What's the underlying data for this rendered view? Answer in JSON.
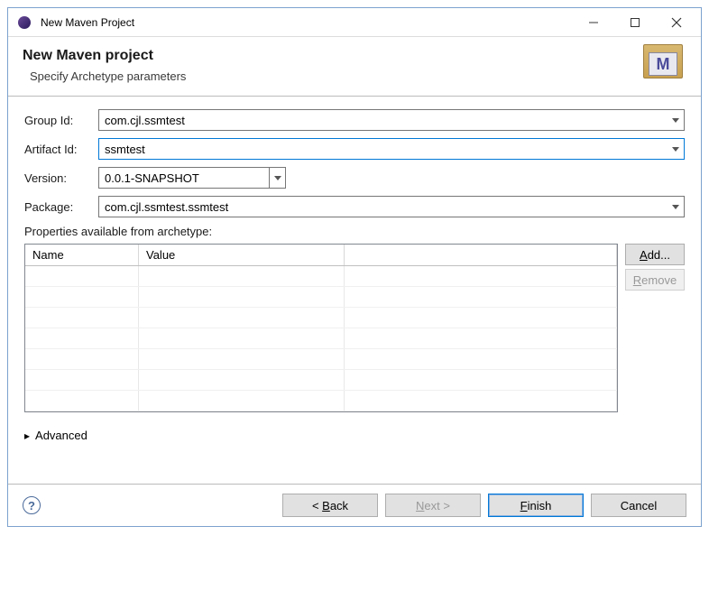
{
  "titlebar": {
    "text": "New Maven Project"
  },
  "header": {
    "title": "New Maven project",
    "subtitle": "Specify Archetype parameters"
  },
  "form": {
    "groupId": {
      "label": "Group Id:",
      "value": "com.cjl.ssmtest"
    },
    "artifactId": {
      "label": "Artifact Id:",
      "value": "ssmtest"
    },
    "version": {
      "label": "Version:",
      "value": "0.0.1-SNAPSHOT"
    },
    "package": {
      "label": "Package:",
      "value": "com.cjl.ssmtest.ssmtest"
    }
  },
  "properties": {
    "label": "Properties available from archetype:",
    "columns": {
      "name": "Name",
      "value": "Value"
    },
    "rows": []
  },
  "buttons": {
    "add": "Add...",
    "remove": "Remove",
    "advanced": "Advanced",
    "back": "< Back",
    "next": "Next >",
    "finish": "Finish",
    "cancel": "Cancel"
  }
}
